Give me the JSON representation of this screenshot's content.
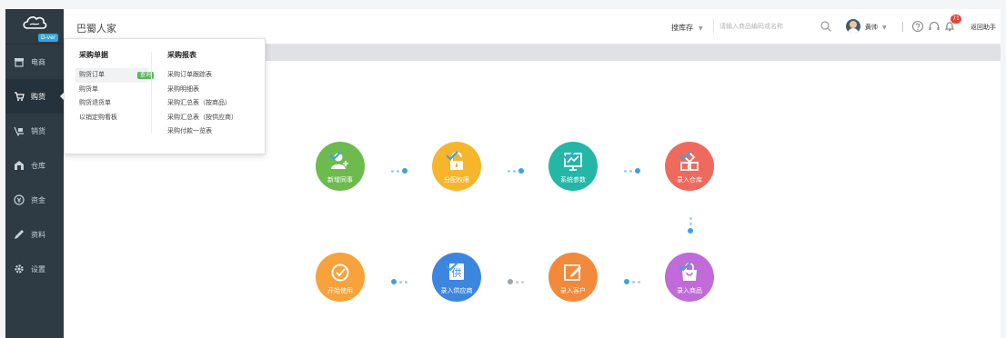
{
  "brand": {
    "version_badge": "D-ver"
  },
  "sidebar": {
    "items": [
      {
        "label": "电商",
        "icon": "store-icon"
      },
      {
        "label": "购货",
        "icon": "cart-icon"
      },
      {
        "label": "销货",
        "icon": "shipping-icon"
      },
      {
        "label": "仓库",
        "icon": "warehouse-icon"
      },
      {
        "label": "资金",
        "icon": "money-icon"
      },
      {
        "label": "资料",
        "icon": "pen-icon"
      },
      {
        "label": "设置",
        "icon": "gear-icon"
      }
    ],
    "active_index": 1
  },
  "header": {
    "company": "巴蜀人家",
    "store_select": "搜库存",
    "search_placeholder": "请输入商品编码或名称",
    "user_name": "黄帅",
    "notification_count": "71",
    "back_link": "返回助手"
  },
  "dropdown": {
    "purchase_docs": {
      "title": "采购单据",
      "items": [
        "购货订单",
        "购货单",
        "购货退货单",
        "以销定购看板"
      ],
      "query_tag": "查询"
    },
    "purchase_reports": {
      "title": "采购报表",
      "items": [
        "采购订单跟踪表",
        "采购明细表",
        "采购汇总表（按商品）",
        "采购汇总表（按供应商）",
        "采购付款一览表"
      ]
    }
  },
  "flow": {
    "steps": [
      {
        "label": "新增同事",
        "color": "#6dbb4e",
        "icon": "add-user-icon"
      },
      {
        "label": "分配权限",
        "color": "#f7b52c",
        "icon": "lock-icon"
      },
      {
        "label": "系统参数",
        "color": "#23b7a6",
        "icon": "chart-monitor-icon"
      },
      {
        "label": "录入仓库",
        "color": "#ef6a5c",
        "icon": "boxes-icon"
      },
      {
        "label": "开始使用",
        "color": "#f7a23a",
        "icon": "check-circle-icon"
      },
      {
        "label": "录入供应商",
        "color": "#3d86e0",
        "icon": "supplier-icon"
      },
      {
        "label": "录入客户",
        "color": "#f3893b",
        "icon": "edit-icon"
      },
      {
        "label": "录入商品",
        "color": "#c06bd8",
        "icon": "bag-icon"
      }
    ],
    "supplier_glyph": "供"
  }
}
